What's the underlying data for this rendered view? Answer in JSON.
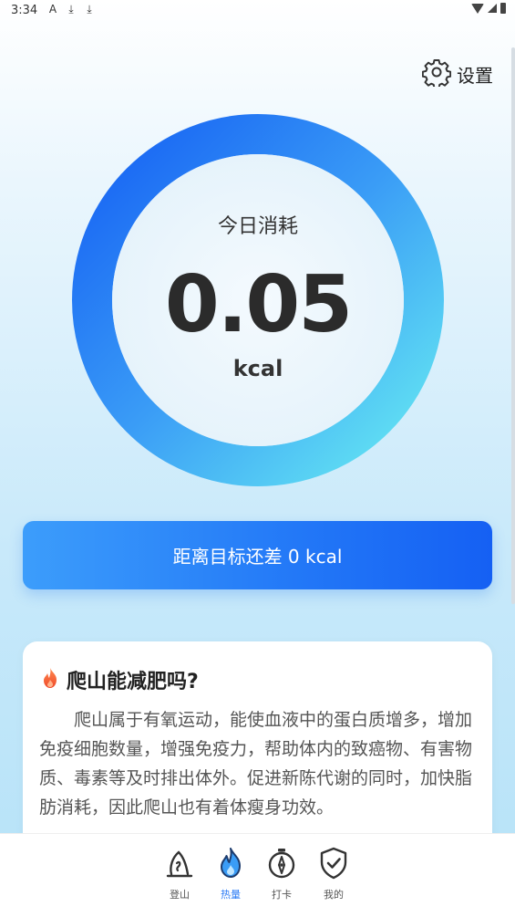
{
  "status_bar": {
    "time": "3:34",
    "notif_icons": [
      "A",
      "⤓",
      "⤓"
    ]
  },
  "header": {
    "settings_label": "设置"
  },
  "ring": {
    "title": "今日消耗",
    "value": "0.05",
    "unit": "kcal",
    "gradient": [
      "#1866f2",
      "#3aa0f6",
      "#63e3f2"
    ]
  },
  "goal_button": {
    "label": "距离目标还差 0 kcal"
  },
  "article": {
    "title": "爬山能减肥吗?",
    "body": "爬山属于有氧运动，能使血液中的蛋白质增多，增加免疫细胞数量，增强免疫力，帮助体内的致癌物、有害物质、毒素等及时排出体外。促进新陈代谢的同时，加快脂肪消耗，因此爬山也有着体瘦身功效。"
  },
  "tabs": [
    {
      "label": "登山",
      "icon": "mountain-icon",
      "active": false
    },
    {
      "label": "热量",
      "icon": "flame-icon",
      "active": true
    },
    {
      "label": "打卡",
      "icon": "stopwatch-icon",
      "active": false
    },
    {
      "label": "我的",
      "icon": "shield-check-icon",
      "active": false
    }
  ],
  "colors": {
    "accent": "#2b7bf5",
    "button_start": "#3c9dfb",
    "button_end": "#1560f3"
  }
}
